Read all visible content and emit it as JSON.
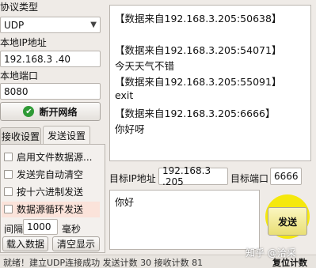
{
  "left": {
    "protocol_label": "协议类型",
    "protocol_value": "UDP",
    "local_ip_label": "本地IP地址",
    "local_ip_value": "192.168.3 .40",
    "local_port_label": "本地端口",
    "local_port_value": "8080",
    "disconnect_label": "断开网络",
    "tabs": [
      "接收设置",
      "发送设置"
    ],
    "options": [
      {
        "label": "启用文件数据源..."
      },
      {
        "label": "发送完自动清空"
      },
      {
        "label": "按十六进制发送"
      },
      {
        "label": "数据源循环发送"
      }
    ],
    "interval_label": "间隔",
    "interval_value": "1000",
    "interval_unit": "毫秒",
    "load_data_label": "载入数据",
    "clear_display_label": "清空显示"
  },
  "log": {
    "lines": [
      "【数据来自192.168.3.205:50638】",
      "【数据来自192.168.3.205:54071】",
      "今天天气不错",
      "【数据来自192.168.3.205:55091】",
      "exit",
      "【数据来自192.168.3.205:6666】",
      "你好呀"
    ]
  },
  "target": {
    "ip_label": "目标IP地址",
    "ip_value": "192.168.3 .205",
    "port_label": "目标端口",
    "port_value": "6666"
  },
  "send": {
    "text": "你好",
    "button_label": "发送"
  },
  "status": {
    "text": "就绪！建立UDP连接成功   发送计数   30      接收计数   81",
    "reset_label": "复位计数"
  },
  "watermark": "知乎 @洽采",
  "colors": {
    "highlight": "#f4e800",
    "connect_icon": "#2f9a36"
  }
}
